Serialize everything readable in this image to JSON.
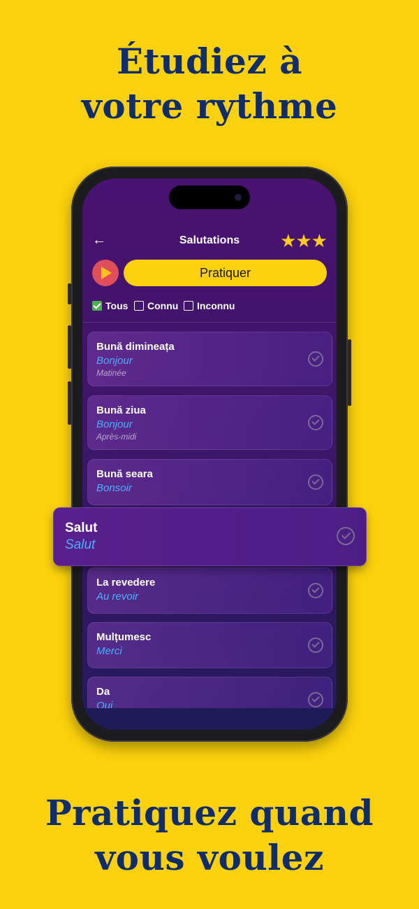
{
  "headline_top": [
    "Étudiez à",
    "votre rythme"
  ],
  "headline_bottom": [
    "Pratiquez quand",
    "vous voulez"
  ],
  "nav": {
    "back_icon": "arrow-left-icon",
    "title": "Salutations",
    "stars": "★★★",
    "rating": 3
  },
  "practice_label": "Pratiquer",
  "filters": [
    {
      "label": "Tous",
      "checked": true
    },
    {
      "label": "Connu",
      "checked": false
    },
    {
      "label": "Inconnu",
      "checked": false
    }
  ],
  "cards": [
    {
      "ro": "Bună dimineața",
      "fr": "Bonjour",
      "note": "Matinée"
    },
    {
      "ro": "Bună ziua",
      "fr": "Bonjour",
      "note": "Après-midi"
    },
    {
      "ro": "Bună seara",
      "fr": "Bonsoir"
    },
    {
      "ro": "La revedere",
      "fr": "Au revoir"
    },
    {
      "ro": "Mulțumesc",
      "fr": "Merci"
    },
    {
      "ro": "Da",
      "fr": "Oui"
    }
  ],
  "highlighted_card": {
    "ro": "Salut",
    "fr": "Salut"
  },
  "colors": {
    "background": "#fbd10d",
    "headline": "#0f2c6b",
    "accent": "#4ab0ff",
    "star": "#ffcc18"
  }
}
